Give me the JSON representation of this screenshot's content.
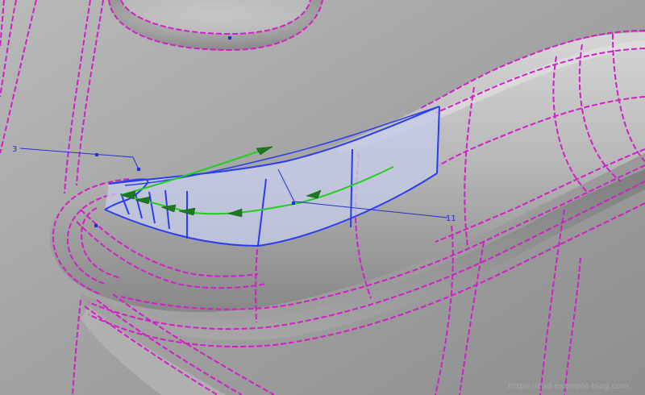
{
  "viewport": {
    "background": "#9a9a9a",
    "shading": "CAD surface model, grey shaded with isoparametric curves"
  },
  "colors": {
    "isocurves": "#d21ec8",
    "patch_boundary": "#2a3ef0",
    "patch_fill": "#c6cbe6",
    "direction_arrows": "#22cc22",
    "arrowheads": "#1e7a1e",
    "callout": "#2233cc"
  },
  "callouts": [
    {
      "id": "callout-3",
      "label": "3"
    },
    {
      "id": "callout-11",
      "label": "11"
    }
  ],
  "icons": [
    "direction-arrow-icon",
    "control-point-icon"
  ],
  "watermark": {
    "text": "https://cad.example-blog.com"
  }
}
